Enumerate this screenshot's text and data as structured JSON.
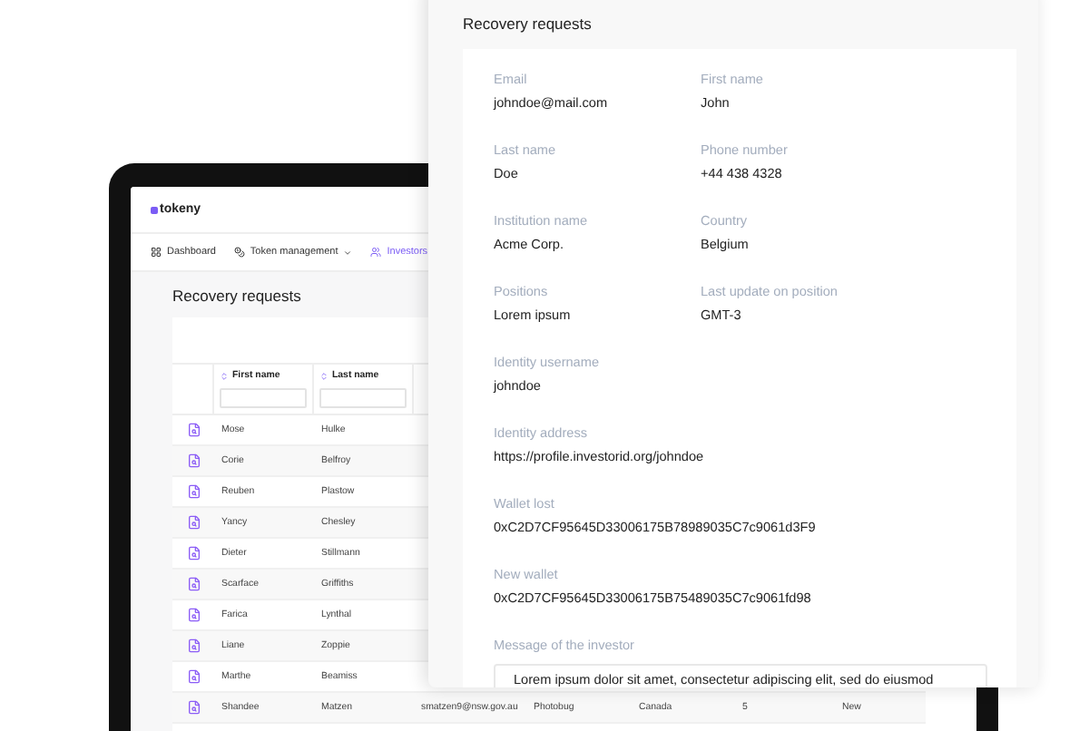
{
  "laptop": {
    "logo": "tokeny",
    "nav": [
      {
        "label": "Dashboard",
        "kind": "grid",
        "selected": false,
        "dropdown": false
      },
      {
        "label": "Token management",
        "kind": "coin",
        "selected": false,
        "dropdown": true
      },
      {
        "label": "Investors",
        "kind": "people",
        "selected": true,
        "dropdown": false
      }
    ],
    "page_title": "Recovery requests",
    "table": {
      "columns": [
        "First name",
        "Last name"
      ],
      "rows": [
        {
          "cells": [
            "Mose",
            "Hulke"
          ]
        },
        {
          "cells": [
            "Corie",
            "Belfroy"
          ]
        },
        {
          "cells": [
            "Reuben",
            "Plastow"
          ]
        },
        {
          "cells": [
            "Yancy",
            "Chesley"
          ]
        },
        {
          "cells": [
            "Dieter",
            "Stillmann"
          ]
        },
        {
          "cells": [
            "Scarface",
            "Griffiths"
          ]
        },
        {
          "cells": [
            "Farica",
            "Lynthal"
          ]
        },
        {
          "cells": [
            "Liane",
            "Zoppie"
          ]
        },
        {
          "cells": [
            "Marthe",
            "Beamiss"
          ]
        },
        {
          "cells": [
            "Shandee",
            "Matzen",
            "smatzen9@nsw.gov.au",
            "Photobug",
            "Canada",
            "5",
            "New"
          ]
        }
      ]
    }
  },
  "panel": {
    "title": "Recovery requests",
    "fields": [
      {
        "kind": "half",
        "label": "Email",
        "value": "johndoe@mail.com"
      },
      {
        "kind": "half",
        "label": "First name",
        "value": "John"
      },
      {
        "kind": "half",
        "label": "Last name",
        "value": "Doe"
      },
      {
        "kind": "half",
        "label": "Phone number",
        "value": "+44 438 4328"
      },
      {
        "kind": "half",
        "label": "Institution name",
        "value": "Acme Corp."
      },
      {
        "kind": "half",
        "label": "Country",
        "value": "Belgium"
      },
      {
        "kind": "half",
        "label": "Positions",
        "value": "Lorem ipsum"
      },
      {
        "kind": "half",
        "label": "Last update on position",
        "value": "GMT-3"
      },
      {
        "kind": "full",
        "label": "Identity username",
        "value": "johndoe"
      },
      {
        "kind": "full",
        "label": "Identity address",
        "value": "https://profile.investorid.org/johndoe"
      },
      {
        "kind": "full",
        "label": "Wallet lost",
        "value": "0xC2D7CF95645D33006175B78989035C7c9061d3F9"
      },
      {
        "kind": "full",
        "label": "New wallet",
        "value": "0xC2D7CF95645D33006175B75489035C7c9061fd98"
      },
      {
        "kind": "message",
        "label": "Message of the investor",
        "value": "Lorem ipsum dolor sit amet, consectetur adipiscing elit, sed do eiusmod"
      }
    ]
  }
}
